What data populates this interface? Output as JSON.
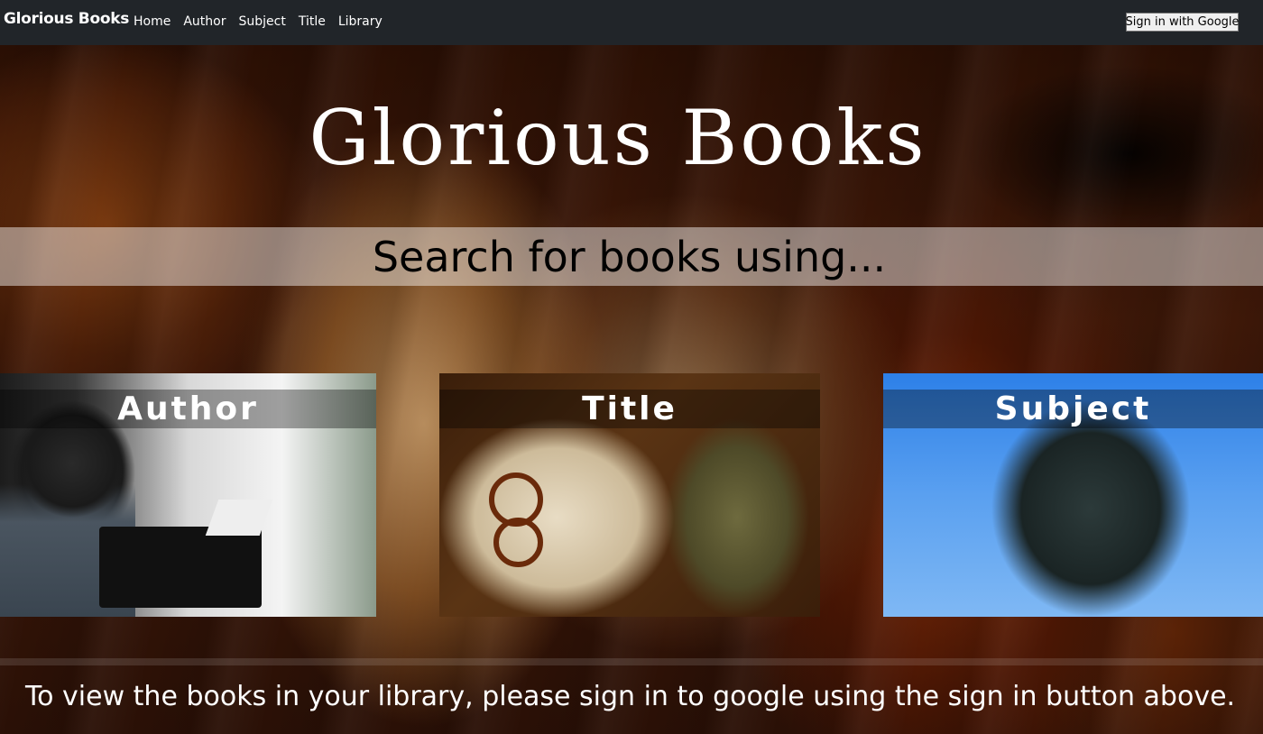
{
  "navbar": {
    "brand": "Glorious Books",
    "links": [
      "Home",
      "Author",
      "Subject",
      "Title",
      "Library"
    ],
    "signin_label": "Sign in with Google"
  },
  "hero": {
    "title": "Glorious Books",
    "search_prompt": "Search for books using...",
    "cards": [
      {
        "label": "Author"
      },
      {
        "label": "Title"
      },
      {
        "label": "Subject"
      }
    ],
    "footer_message": "To view the books in your library, please sign in to google using the sign in button above."
  }
}
